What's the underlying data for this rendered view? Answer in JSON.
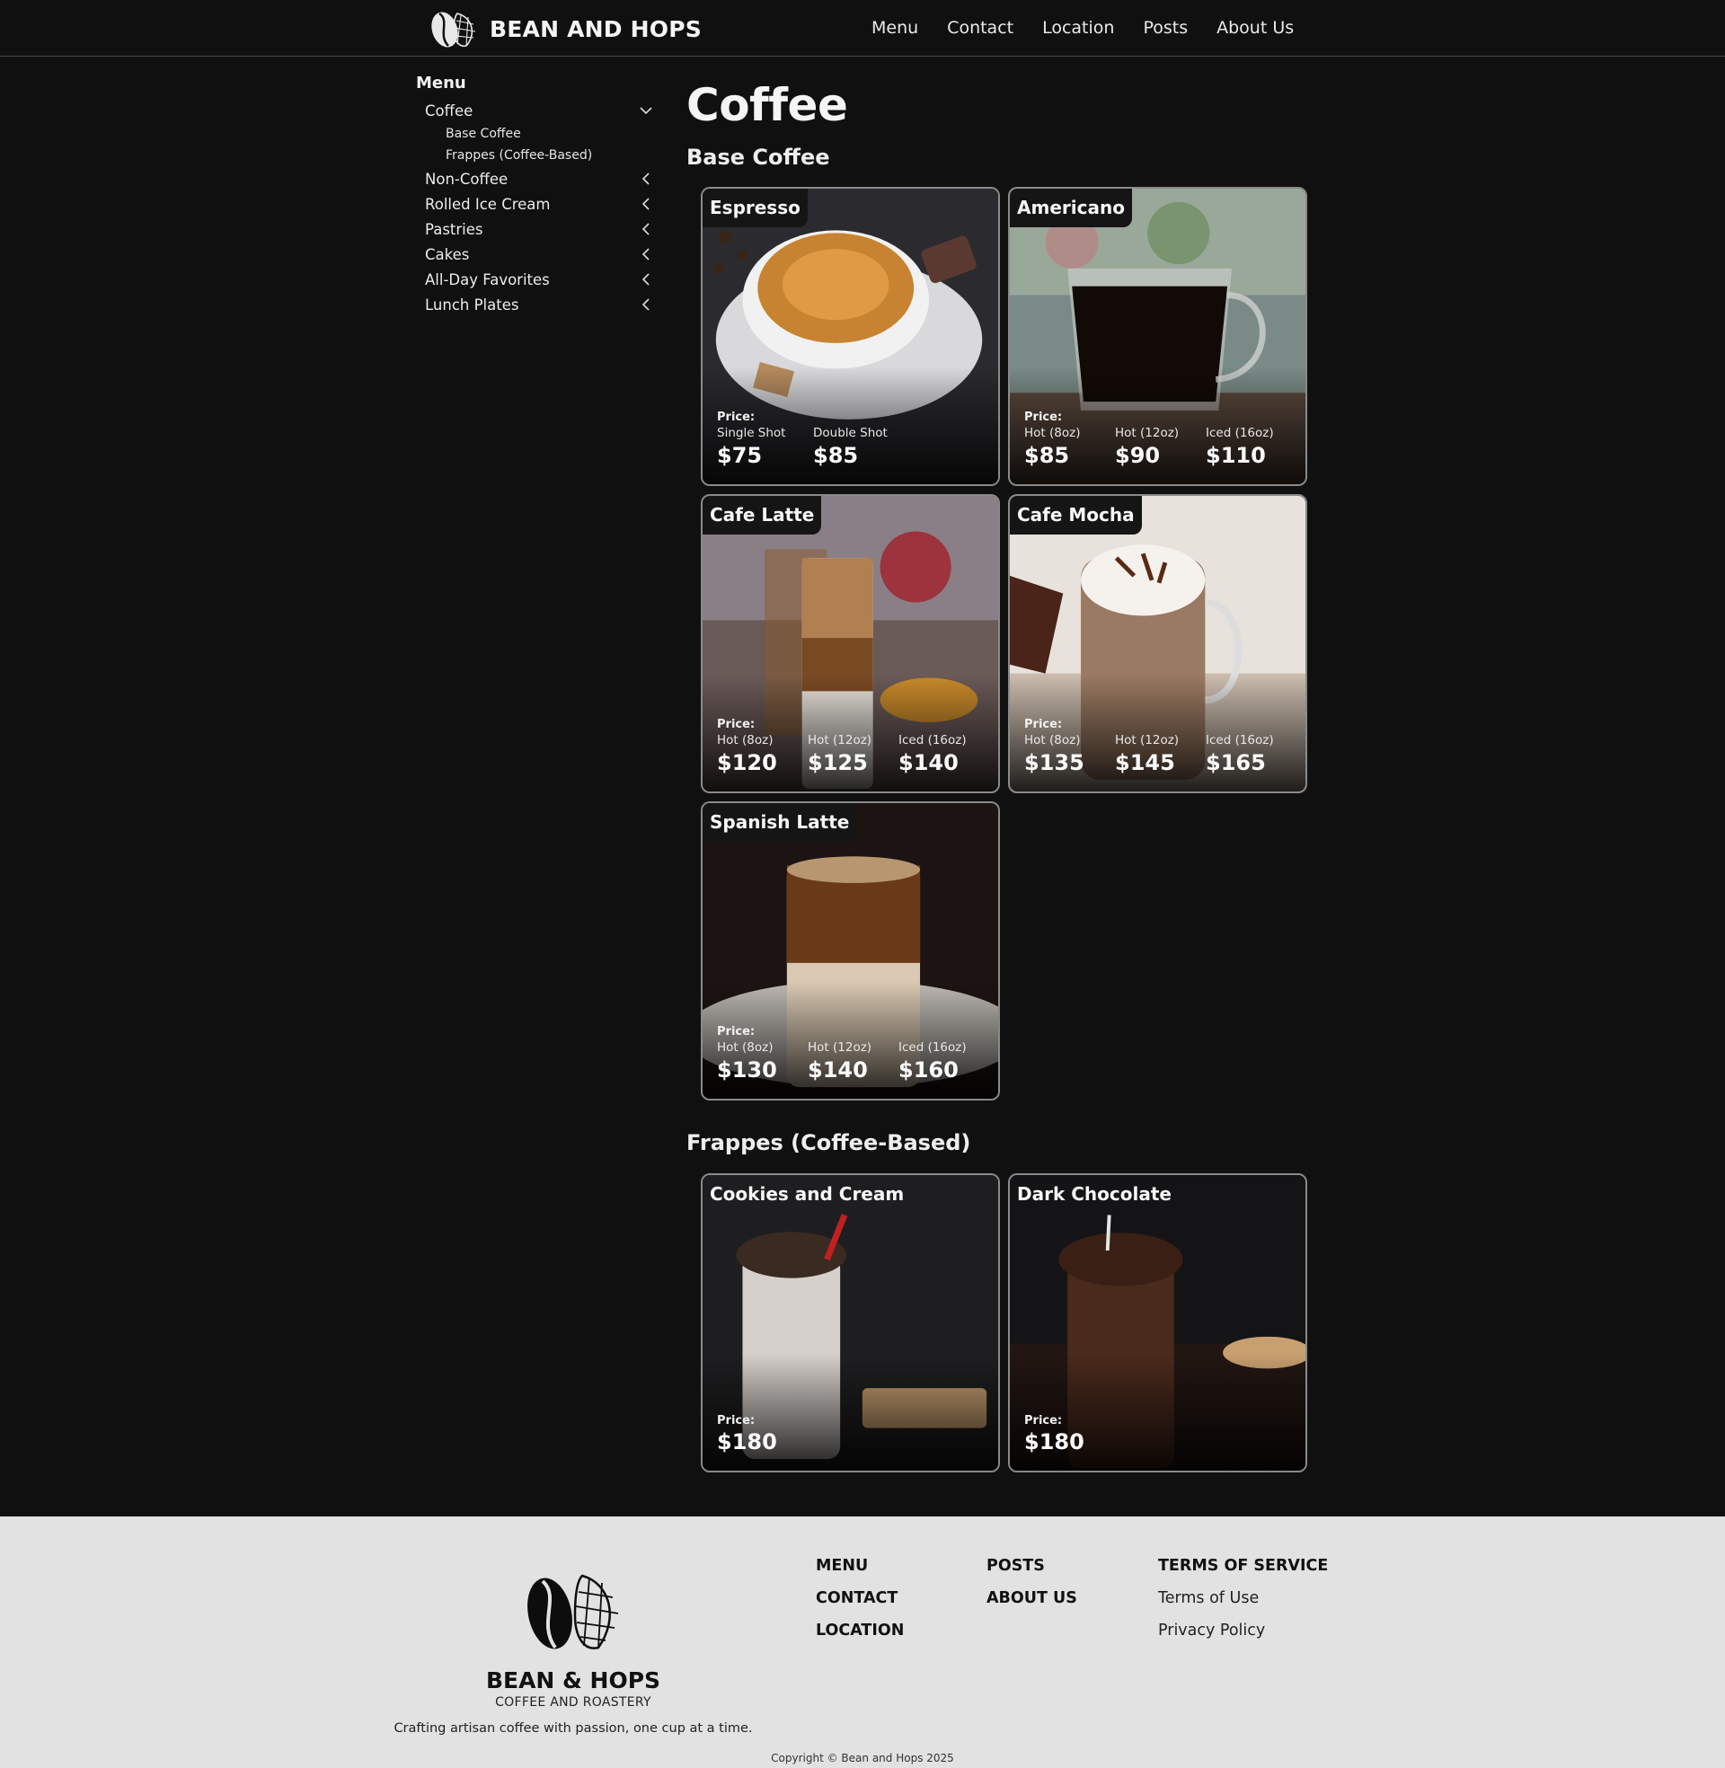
{
  "header": {
    "brand_name": "BEAN AND HOPS",
    "nav": [
      "Menu",
      "Contact",
      "Location",
      "Posts",
      "About Us"
    ]
  },
  "sidebar": {
    "title": "Menu",
    "items": [
      {
        "label": "Coffee",
        "expanded": true,
        "children": [
          "Base Coffee",
          "Frappes (Coffee-Based)"
        ]
      },
      {
        "label": "Non-Coffee",
        "expanded": false
      },
      {
        "label": "Rolled Ice Cream",
        "expanded": false
      },
      {
        "label": "Pastries",
        "expanded": false
      },
      {
        "label": "Cakes",
        "expanded": false
      },
      {
        "label": "All-Day Favorites",
        "expanded": false
      },
      {
        "label": "Lunch Plates",
        "expanded": false
      }
    ]
  },
  "main": {
    "title": "Coffee",
    "sections": [
      {
        "title": "Base Coffee",
        "items": [
          {
            "name": "Espresso",
            "price_label": "Price:",
            "prices": [
              {
                "size": "Single Shot",
                "amount": "$75"
              },
              {
                "size": "Double Shot",
                "amount": "$85"
              }
            ]
          },
          {
            "name": "Americano",
            "price_label": "Price:",
            "prices": [
              {
                "size": "Hot (8oz)",
                "amount": "$85"
              },
              {
                "size": "Hot (12oz)",
                "amount": "$90"
              },
              {
                "size": "Iced (16oz)",
                "amount": "$110"
              }
            ]
          },
          {
            "name": "Cafe Latte",
            "price_label": "Price:",
            "prices": [
              {
                "size": "Hot (8oz)",
                "amount": "$120"
              },
              {
                "size": "Hot (12oz)",
                "amount": "$125"
              },
              {
                "size": "Iced (16oz)",
                "amount": "$140"
              }
            ]
          },
          {
            "name": "Cafe Mocha",
            "price_label": "Price:",
            "prices": [
              {
                "size": "Hot (8oz)",
                "amount": "$135"
              },
              {
                "size": "Hot (12oz)",
                "amount": "$145"
              },
              {
                "size": "Iced (16oz)",
                "amount": "$165"
              }
            ]
          },
          {
            "name": "Spanish Latte",
            "price_label": "Price:",
            "prices": [
              {
                "size": "Hot (8oz)",
                "amount": "$130"
              },
              {
                "size": "Hot (12oz)",
                "amount": "$140"
              },
              {
                "size": "Iced (16oz)",
                "amount": "$160"
              }
            ]
          }
        ]
      },
      {
        "title": "Frappes (Coffee-Based)",
        "items": [
          {
            "name": "Cookies and Cream",
            "price_label": "Price:",
            "prices": [
              {
                "size": "",
                "amount": "$180"
              }
            ]
          },
          {
            "name": "Dark Chocolate",
            "price_label": "Price:",
            "prices": [
              {
                "size": "",
                "amount": "$180"
              }
            ]
          }
        ]
      }
    ]
  },
  "footer": {
    "brand": "BEAN & HOPS",
    "subtitle": "COFFEE AND ROASTERY",
    "tagline": "Crafting artisan coffee with passion, one cup at a time.",
    "col1": [
      "MENU",
      "CONTACT",
      "LOCATION"
    ],
    "col2": [
      "POSTS",
      "ABOUT US"
    ],
    "col3_title": "TERMS OF SERVICE",
    "col3": [
      "Terms of Use",
      "Privacy Policy"
    ],
    "copyright": "Copyright © Bean and Hops 2025"
  },
  "colors": {
    "background": "#101011",
    "footer_bg": "#e2e2e2",
    "card_border": "#8a8a8a"
  }
}
